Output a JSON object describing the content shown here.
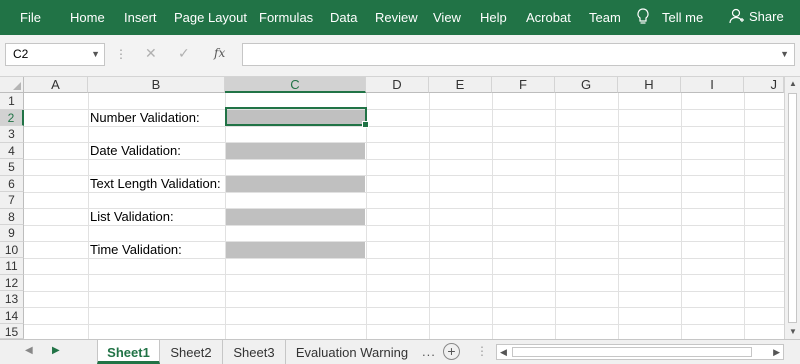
{
  "ribbon": {
    "tabs": [
      "File",
      "Home",
      "Insert",
      "Page Layout",
      "Formulas",
      "Data",
      "Review",
      "View",
      "Help",
      "Acrobat",
      "Team"
    ],
    "tell_me": "Tell me",
    "share": "Share",
    "accent_color": "#217346"
  },
  "formula_bar": {
    "name_box": "C2",
    "formula": "",
    "fx_label": "fx"
  },
  "grid": {
    "columns": [
      "A",
      "B",
      "C",
      "D",
      "E",
      "F",
      "G",
      "H",
      "I",
      "J"
    ],
    "rows": [
      "1",
      "2",
      "3",
      "4",
      "5",
      "6",
      "7",
      "8",
      "9",
      "10",
      "11",
      "12",
      "13",
      "14",
      "15"
    ],
    "selected_column": "C",
    "selected_row": "2",
    "labels": [
      {
        "row": "2",
        "text": "Number Validation:"
      },
      {
        "row": "4",
        "text": "Date Validation:"
      },
      {
        "row": "6",
        "text": "Text Length Validation:"
      },
      {
        "row": "8",
        "text": "List Validation:"
      },
      {
        "row": "10",
        "text": "Time Validation:"
      }
    ],
    "fill_color": "#c0c0c0"
  },
  "sheets": {
    "tabs": [
      "Sheet1",
      "Sheet2",
      "Sheet3",
      "Evaluation Warning"
    ],
    "active": "Sheet1",
    "more": "...",
    "add": "+"
  }
}
